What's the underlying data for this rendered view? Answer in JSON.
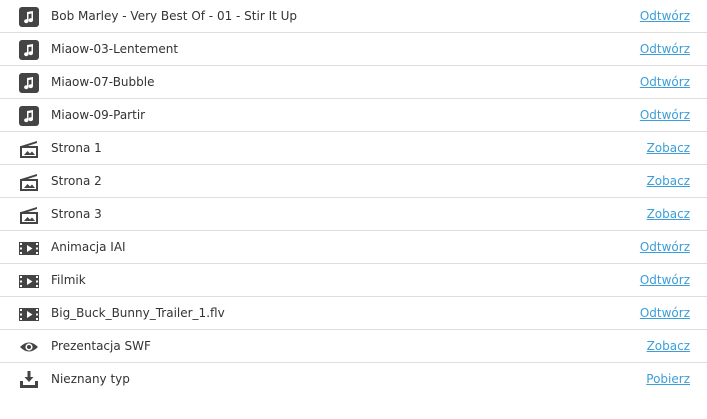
{
  "colors": {
    "link": "#3b9ed8",
    "text": "#333333",
    "divider": "#dddddd",
    "icon": "#444444"
  },
  "files": [
    {
      "name": "Bob Marley - Very Best Of - 01 - Stir It Up",
      "action": "Odtwórz",
      "icon": "music-note-icon"
    },
    {
      "name": "Miaow-03-Lentement",
      "action": "Odtwórz",
      "icon": "music-note-icon"
    },
    {
      "name": "Miaow-07-Bubble",
      "action": "Odtwórz",
      "icon": "music-note-icon"
    },
    {
      "name": "Miaow-09-Partir",
      "action": "Odtwórz",
      "icon": "music-note-icon"
    },
    {
      "name": "Strona 1",
      "action": "Zobacz",
      "icon": "webpage-icon"
    },
    {
      "name": "Strona 2",
      "action": "Zobacz",
      "icon": "webpage-icon"
    },
    {
      "name": "Strona 3",
      "action": "Zobacz",
      "icon": "webpage-icon"
    },
    {
      "name": "Animacja IAI",
      "action": "Odtwórz",
      "icon": "video-icon"
    },
    {
      "name": "Filmik",
      "action": "Odtwórz",
      "icon": "video-icon"
    },
    {
      "name": "Big_Buck_Bunny_Trailer_1.flv",
      "action": "Odtwórz",
      "icon": "video-icon"
    },
    {
      "name": "Prezentacja SWF",
      "action": "Zobacz",
      "icon": "eye-icon"
    },
    {
      "name": "Nieznany typ",
      "action": "Pobierz",
      "icon": "download-icon"
    }
  ]
}
